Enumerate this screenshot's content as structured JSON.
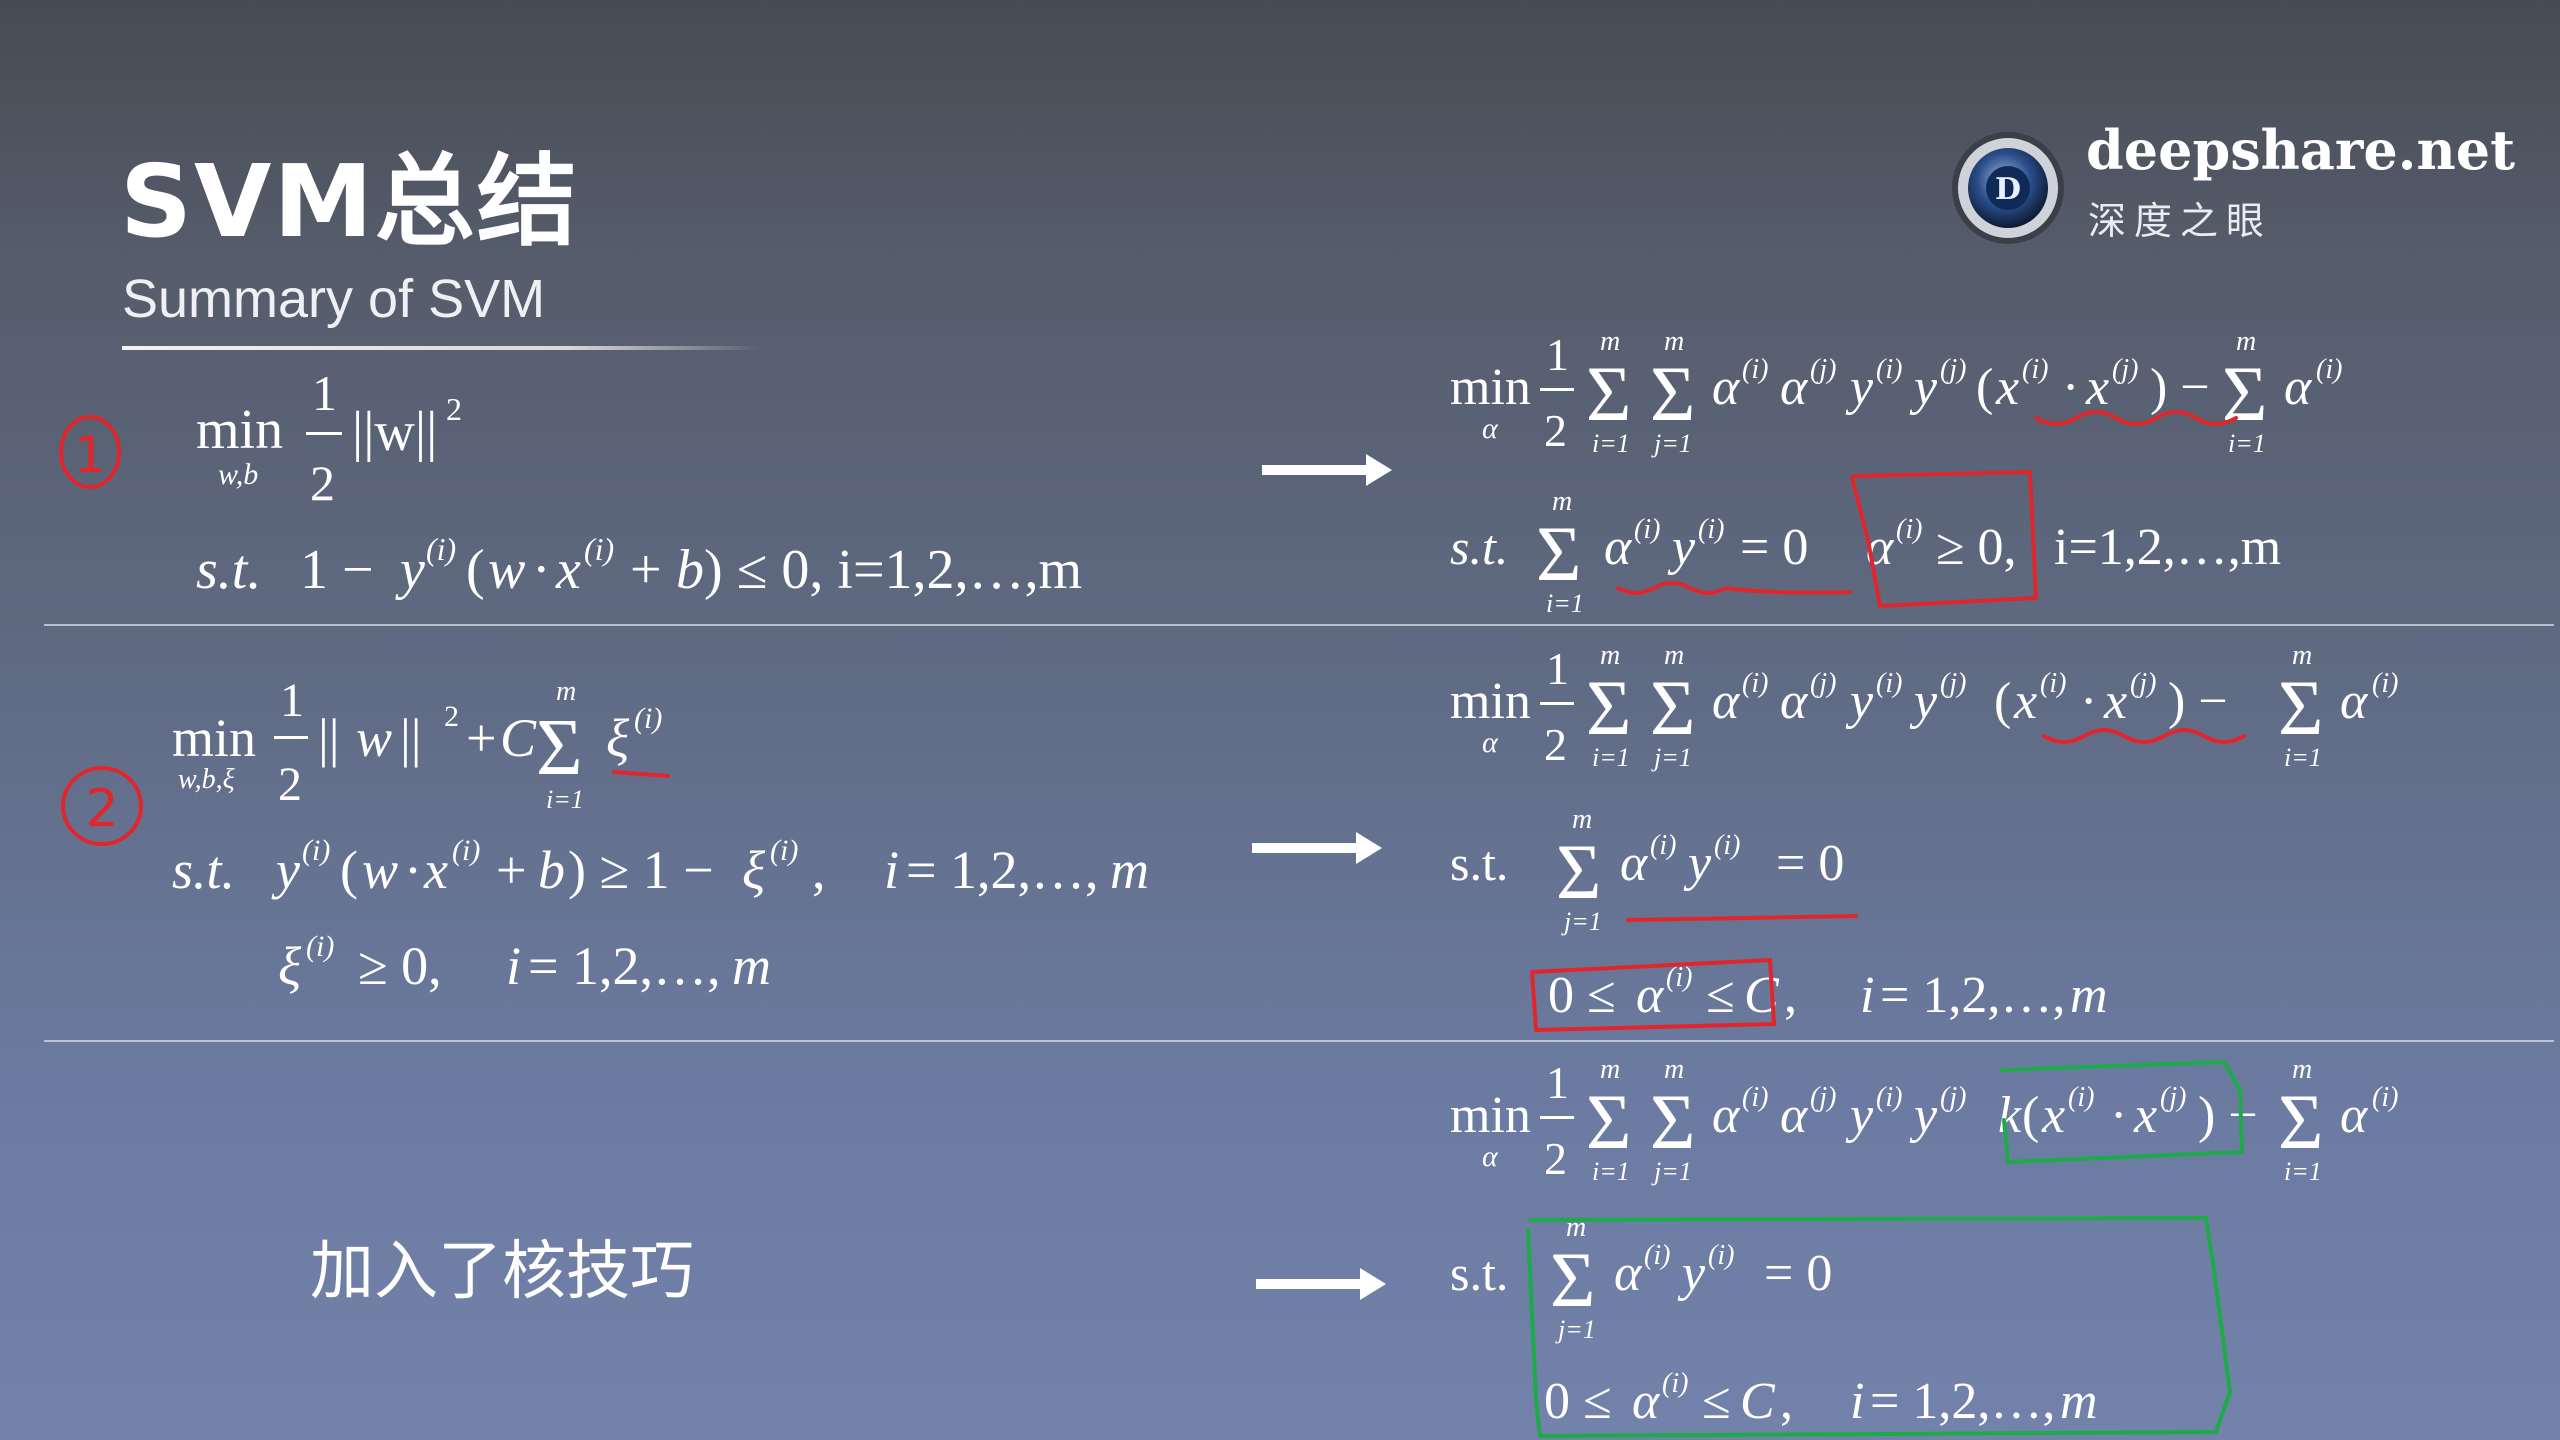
{
  "slide": {
    "title": "SVM总结",
    "subtitle": "Summary of SVM"
  },
  "brand": {
    "name": "deepshare.net",
    "tagline": "深度之眼",
    "logo_letter": "D"
  },
  "annotations": {
    "circle_1": "1",
    "circle_2": "2",
    "ink_red": "#e0262b",
    "ink_green": "#1faa4a"
  },
  "sections": [
    {
      "primal": {
        "objective": "min_{w,b} (1/2)||w||^2",
        "constraint": "s.t. 1 − y^(i)(w·x^(i) + b) ≤ 0, i=1,2,…,m"
      },
      "dual": {
        "objective": "min_α (1/2) Σ_{i=1}^{m} Σ_{j=1}^{m} α^(i)α^(j)y^(i)y^(j)(x^(i)·x^(j)) − Σ_{i=1}^{m} α^(i)",
        "constraint": "s.t. Σ_{i=1}^{m} α^(i)y^(i) = 0, α^(i) ≥ 0, i=1,2,…,m"
      }
    },
    {
      "primal": {
        "objective": "min_{w,b,ξ} (1/2)||w||^2 + C Σ_{i=1}^{m} ξ^(i)",
        "constraint_1": "s.t. y^(i)(w·x^(i) + b) ≥ 1 − ξ^(i), i = 1,2,…,m",
        "constraint_2": "ξ^(i) ≥ 0, i = 1,2,…,m"
      },
      "dual": {
        "objective": "min_α (1/2) Σ_{i=1}^{m} Σ_{j=1}^{m} α^(i)α^(j)y^(i)y^(j)(x^(i)·x^(j)) − Σ_{i=1}^{m} α^(i)",
        "constraint_1": "s.t. Σ_{j=1}^{m} α^(i)y^(i) = 0",
        "constraint_2": "0 ≤ α^(i) ≤ C, i = 1,2,…,m"
      }
    },
    {
      "label": "加入了核技巧",
      "dual": {
        "objective": "min_α (1/2) Σ_{i=1}^{m} Σ_{j=1}^{m} α^(i)α^(j)y^(i)y^(j)k(x^(i)·x^(j)) − Σ_{i=1}^{m} α^(i)",
        "constraint_1": "s.t. Σ_{j=1}^{m} α^(i)y^(i) = 0",
        "constraint_2": "0 ≤ α^(i) ≤ C, i = 1,2,…,m"
      }
    }
  ]
}
